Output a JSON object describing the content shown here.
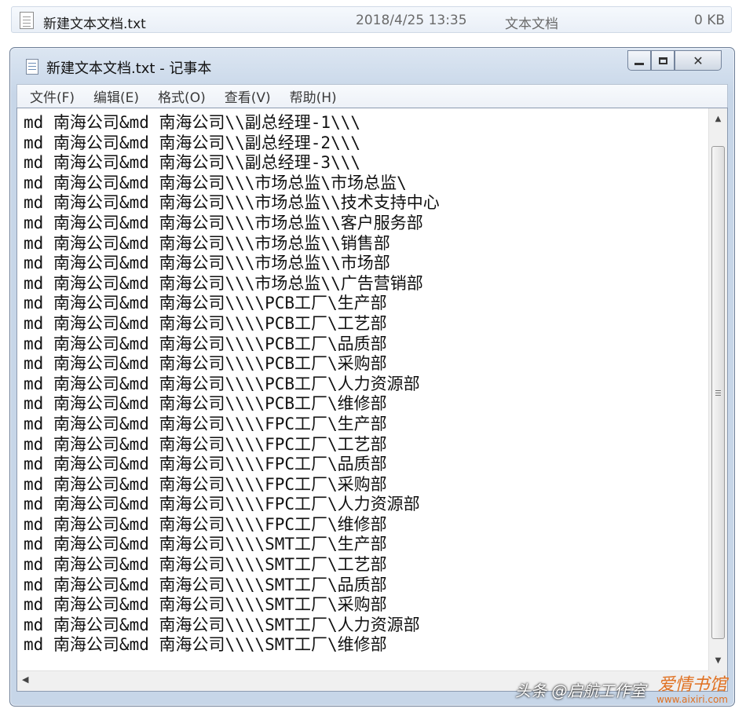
{
  "file_row": {
    "name": "新建文本文档.txt",
    "date": "2018/4/25 13:35",
    "type": "文本文档",
    "size": "0 KB"
  },
  "window": {
    "title": "新建文本文档.txt - 记事本",
    "buttons": {
      "minimize": "minimize",
      "maximize": "maximize",
      "close": "✕"
    }
  },
  "menu": {
    "items": [
      "文件(F)",
      "编辑(E)",
      "格式(O)",
      "查看(V)",
      "帮助(H)"
    ]
  },
  "document": {
    "lines": [
      "md 南海公司&md 南海公司\\\\副总经理-1\\\\\\",
      "md 南海公司&md 南海公司\\\\副总经理-2\\\\\\",
      "md 南海公司&md 南海公司\\\\副总经理-3\\\\\\",
      "md 南海公司&md 南海公司\\\\\\市场总监\\市场总监\\",
      "md 南海公司&md 南海公司\\\\\\市场总监\\\\技术支持中心",
      "md 南海公司&md 南海公司\\\\\\市场总监\\\\客户服务部",
      "md 南海公司&md 南海公司\\\\\\市场总监\\\\销售部",
      "md 南海公司&md 南海公司\\\\\\市场总监\\\\市场部",
      "md 南海公司&md 南海公司\\\\\\市场总监\\\\广告营销部",
      "md 南海公司&md 南海公司\\\\\\\\PCB工厂\\生产部",
      "md 南海公司&md 南海公司\\\\\\\\PCB工厂\\工艺部",
      "md 南海公司&md 南海公司\\\\\\\\PCB工厂\\品质部",
      "md 南海公司&md 南海公司\\\\\\\\PCB工厂\\采购部",
      "md 南海公司&md 南海公司\\\\\\\\PCB工厂\\人力资源部",
      "md 南海公司&md 南海公司\\\\\\\\PCB工厂\\维修部",
      "md 南海公司&md 南海公司\\\\\\\\FPC工厂\\生产部",
      "md 南海公司&md 南海公司\\\\\\\\FPC工厂\\工艺部",
      "md 南海公司&md 南海公司\\\\\\\\FPC工厂\\品质部",
      "md 南海公司&md 南海公司\\\\\\\\FPC工厂\\采购部",
      "md 南海公司&md 南海公司\\\\\\\\FPC工厂\\人力资源部",
      "md 南海公司&md 南海公司\\\\\\\\FPC工厂\\维修部",
      "md 南海公司&md 南海公司\\\\\\\\SMT工厂\\生产部",
      "md 南海公司&md 南海公司\\\\\\\\SMT工厂\\工艺部",
      "md 南海公司&md 南海公司\\\\\\\\SMT工厂\\品质部",
      "md 南海公司&md 南海公司\\\\\\\\SMT工厂\\采购部",
      "md 南海公司&md 南海公司\\\\\\\\SMT工厂\\人力资源部",
      "md 南海公司&md 南海公司\\\\\\\\SMT工厂\\维修部"
    ]
  },
  "scrollbar": {
    "up_icon": "arrow-up-icon",
    "down_icon": "arrow-down-icon",
    "left_icon": "arrow-left-icon",
    "up_glyph": "▲",
    "down_glyph": "▼",
    "left_glyph": "◀"
  },
  "watermark": {
    "text": "头条 @启航工作室",
    "site_cn": "爱情书馆",
    "site_en": "www.aixiri.com"
  }
}
